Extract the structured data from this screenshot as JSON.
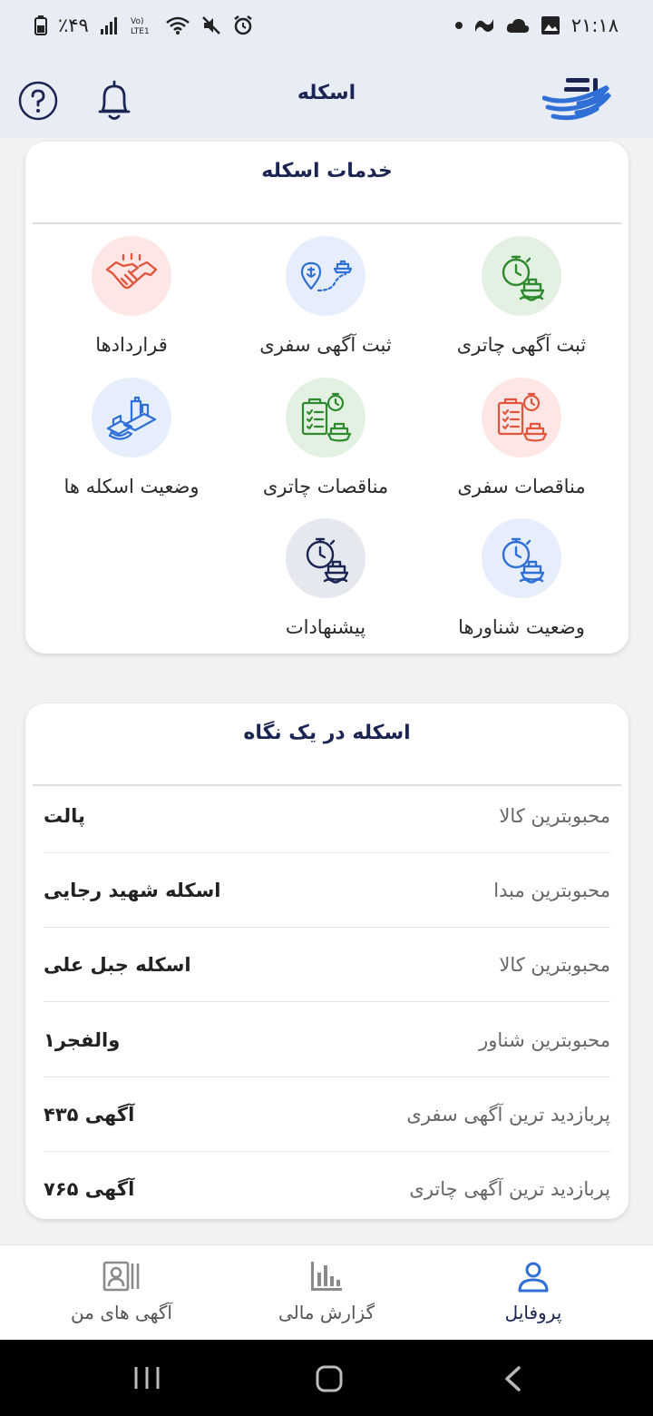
{
  "status_bar": {
    "time": "۲۱:۱۸",
    "battery": "٪۴۹"
  },
  "header": {
    "title": "اسکله"
  },
  "services": {
    "title": "خدمات اسکله",
    "items": [
      {
        "label": "ثبت آگهی چاتری",
        "icon": "stopwatch-ship-icon"
      },
      {
        "label": "ثبت آگهی سفری",
        "icon": "route-pin-ship-icon"
      },
      {
        "label": "قراردادها",
        "icon": "handshake-icon"
      },
      {
        "label": "مناقصات سفری",
        "icon": "clipboard-stopwatch-ship-icon"
      },
      {
        "label": "مناقصات  چاتری",
        "icon": "clipboard-stopwatch-ship-icon"
      },
      {
        "label": "وضعیت اسکله ها",
        "icon": "pier-building-boat-icon"
      },
      {
        "label": "وضعیت شناورها",
        "icon": "stopwatch-ship-icon"
      },
      {
        "label": "پیشنهادات",
        "icon": "stopwatch-ship-icon"
      }
    ]
  },
  "glance": {
    "title": "اسکله در یک نگاه",
    "rows": [
      {
        "key": "محبوبترین کالا",
        "value": "پالت"
      },
      {
        "key": "محبوبترین مبدا",
        "value": "اسکله شهید رجایی"
      },
      {
        "key": "محبوبترین کالا",
        "value": "اسکله جبل علی"
      },
      {
        "key": "محبوبترین شناور",
        "value": "والفجر۱"
      },
      {
        "key": "پربازدید ترین آگهی سفری",
        "value": "آگهی  ۴۳۵"
      },
      {
        "key": "پربازدید ترین آگهی چاتری",
        "value": "آگهی  ۷۶۵"
      }
    ]
  },
  "bottom_nav": {
    "profile": "پروفایل",
    "financial": "گزارش مالی",
    "my_ads": "آگهی های من"
  },
  "colors": {
    "primary": "#1b2552",
    "accent_blue": "#2f6fd6",
    "green": "#2f8a2f",
    "red": "#e2553d"
  }
}
